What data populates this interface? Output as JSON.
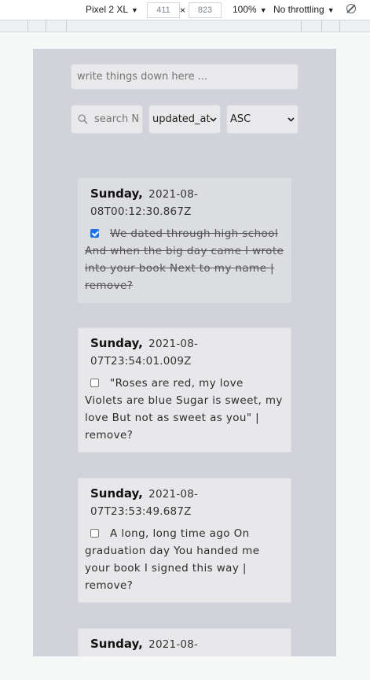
{
  "devtools": {
    "device": "Pixel 2 XL",
    "width": "411",
    "height": "823",
    "zoom": "100%",
    "throttling": "No throttling",
    "times": "×"
  },
  "form": {
    "note_placeholder": "write things down here ...",
    "search_placeholder": "search Notes",
    "sort_field": "updated_at",
    "sort_order": "ASC"
  },
  "notes": [
    {
      "weekday": "Sunday,",
      "timestamp": "2021-08-08T00:12:30.867Z",
      "text": "We dated through high school And when the big day came I wrote into your book Next to my name | remove?",
      "done": true
    },
    {
      "weekday": "Sunday,",
      "timestamp": "2021-08-07T23:54:01.009Z",
      "text": "\"Roses are red, my love Violets are blue Sugar is sweet, my love But not as sweet as you\" | remove?",
      "done": false
    },
    {
      "weekday": "Sunday,",
      "timestamp": "2021-08-07T23:53:49.687Z",
      "text": "A long, long time ago On graduation day You handed me your book I signed this way | remove?",
      "done": false
    },
    {
      "weekday": "Sunday,",
      "timestamp": "2021-08-",
      "text": "",
      "done": false
    }
  ],
  "colors": {
    "viewport_bg": "#d2d3da",
    "card_bg": "#e8e8eb",
    "checkbox_checked": "#1a73e8"
  }
}
